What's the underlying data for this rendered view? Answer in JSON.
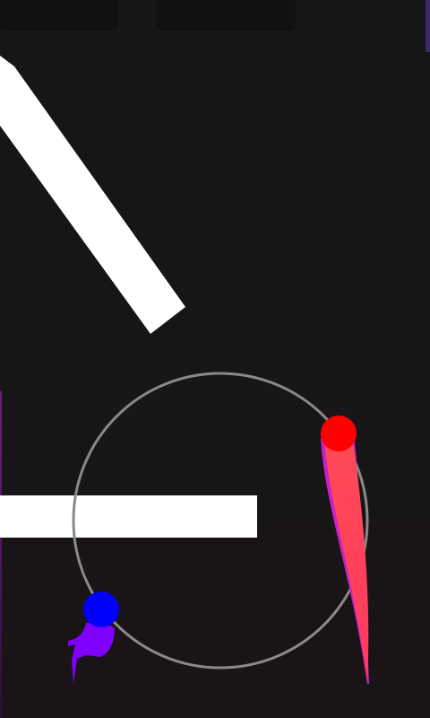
{
  "screen": {
    "background": "#161616"
  },
  "hud": {
    "left_panel_color": "#111111",
    "right_panel_color": "#111111",
    "corner_accent_color": "#3a2a6a"
  },
  "orbit": {
    "stroke_color": "#8a8a8a"
  },
  "obstacles": {
    "color": "#ffffff"
  },
  "balls": {
    "red": {
      "color": "#ff0000",
      "trail_color": "#ff4a55",
      "trail_edge": "#c820c8"
    },
    "blue": {
      "color": "#0000ff",
      "trail_color": "#8000ff",
      "trail_edge": "#6a00d8"
    }
  }
}
